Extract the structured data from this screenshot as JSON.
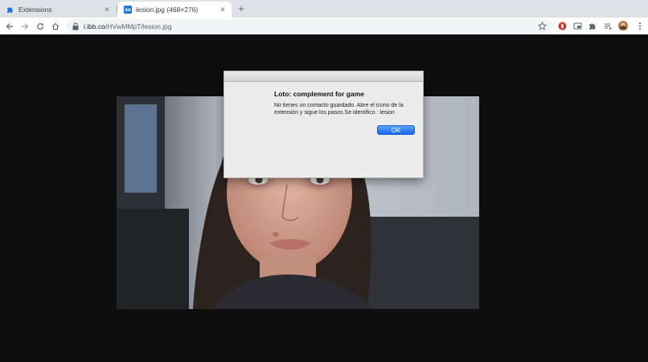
{
  "browser": {
    "tabs": [
      {
        "title": "Extensions",
        "icon": "puzzle-icon",
        "active": false
      },
      {
        "title": "lesion.jpg (468×276)",
        "icon": "image-favicon-icon",
        "active": true
      }
    ],
    "new_tab_label": "+",
    "close_glyph": "×",
    "url": {
      "host": "i.ibb.co",
      "path": "/HVwMMpT/lesion.jpg"
    }
  },
  "dialog": {
    "title": "Loto: complement for game",
    "message": "No tienes un contacto guardado. Abre el icono de la extensión y sigue los pasos.Se identifico : lesion",
    "ok_label": "OK"
  },
  "image": {
    "subject": "portrait-photo"
  },
  "colors": {
    "accent": "#1a73e8",
    "dialog_button": "#1767f0",
    "page_bg": "#0e0e0e"
  }
}
